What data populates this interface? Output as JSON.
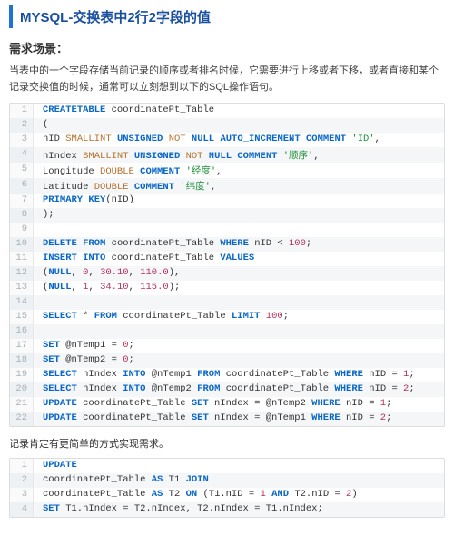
{
  "title": "MYSQL-交换表中2行2字段的值",
  "section_heading": "需求场景：",
  "paragraph": "当表中的一个字段存储当前记录的顺序或者排名时候，它需要进行上移或者下移，或者直接和某个记录交换值的时候，通常可以立刻想到以下的SQL操作语句。",
  "note": "记录肯定有更简单的方式实现需求。",
  "block1": [
    {
      "n": "1",
      "tokens": [
        [
          "kw",
          "CREATE"
        ],
        [
          "",
          ""
        ],
        [
          "kw",
          "TABLE"
        ],
        [
          "",
          " coordinatePt_Table"
        ]
      ]
    },
    {
      "n": "2",
      "tokens": [
        [
          "",
          "("
        ]
      ]
    },
    {
      "n": "3",
      "tokens": [
        [
          "",
          "nID "
        ],
        [
          "type",
          "SMALLINT"
        ],
        [
          "",
          " "
        ],
        [
          "kw",
          "UNSIGNED"
        ],
        [
          "",
          " "
        ],
        [
          "type",
          "NOT"
        ],
        [
          "",
          " "
        ],
        [
          "kw",
          "NULL"
        ],
        [
          "",
          " "
        ],
        [
          "kw",
          "AUTO_INCREMENT"
        ],
        [
          "",
          " "
        ],
        [
          "kw",
          "COMMENT"
        ],
        [
          "",
          " "
        ],
        [
          "str",
          "'ID'"
        ],
        [
          "",
          ","
        ]
      ]
    },
    {
      "n": "4",
      "tokens": [
        [
          "",
          "nIndex "
        ],
        [
          "type",
          "SMALLINT"
        ],
        [
          "",
          " "
        ],
        [
          "kw",
          "UNSIGNED"
        ],
        [
          "",
          " "
        ],
        [
          "type",
          "NOT"
        ],
        [
          "",
          " "
        ],
        [
          "kw",
          "NULL"
        ],
        [
          "",
          " "
        ],
        [
          "kw",
          "COMMENT"
        ],
        [
          "",
          " "
        ],
        [
          "str",
          "'顺序'"
        ],
        [
          "",
          ","
        ]
      ]
    },
    {
      "n": "5",
      "tokens": [
        [
          "",
          "Longitude "
        ],
        [
          "type",
          "DOUBLE"
        ],
        [
          "",
          " "
        ],
        [
          "kw",
          "COMMENT"
        ],
        [
          "",
          " "
        ],
        [
          "str",
          "'经度'"
        ],
        [
          "",
          ","
        ]
      ]
    },
    {
      "n": "6",
      "tokens": [
        [
          "",
          "Latitude "
        ],
        [
          "type",
          "DOUBLE"
        ],
        [
          "",
          " "
        ],
        [
          "kw",
          "COMMENT"
        ],
        [
          "",
          " "
        ],
        [
          "str",
          "'纬度'"
        ],
        [
          "",
          ","
        ]
      ]
    },
    {
      "n": "7",
      "tokens": [
        [
          "kw",
          "PRIMARY"
        ],
        [
          "",
          " "
        ],
        [
          "kw",
          "KEY"
        ],
        [
          "",
          "(nID)"
        ]
      ]
    },
    {
      "n": "8",
      "tokens": [
        [
          "",
          ");"
        ]
      ]
    },
    {
      "n": "9",
      "tokens": [
        [
          "",
          ""
        ]
      ]
    },
    {
      "n": "10",
      "tokens": [
        [
          "kw",
          "DELETE"
        ],
        [
          "",
          " "
        ],
        [
          "kw",
          "FROM"
        ],
        [
          "",
          " coordinatePt_Table "
        ],
        [
          "kw",
          "WHERE"
        ],
        [
          "",
          " nID < "
        ],
        [
          "num",
          "100"
        ],
        [
          "",
          ";"
        ]
      ]
    },
    {
      "n": "11",
      "tokens": [
        [
          "kw",
          "INSERT"
        ],
        [
          "",
          " "
        ],
        [
          "kw",
          "INTO"
        ],
        [
          "",
          " coordinatePt_Table "
        ],
        [
          "kw",
          "VALUES"
        ]
      ]
    },
    {
      "n": "12",
      "tokens": [
        [
          "",
          "("
        ],
        [
          "kw",
          "NULL"
        ],
        [
          "",
          ", "
        ],
        [
          "num",
          "0"
        ],
        [
          "",
          ", "
        ],
        [
          "num",
          "30.10"
        ],
        [
          "",
          ", "
        ],
        [
          "num",
          "110.0"
        ],
        [
          "",
          "),"
        ]
      ]
    },
    {
      "n": "13",
      "tokens": [
        [
          "",
          "("
        ],
        [
          "kw",
          "NULL"
        ],
        [
          "",
          ", "
        ],
        [
          "num",
          "1"
        ],
        [
          "",
          ", "
        ],
        [
          "num",
          "34.10"
        ],
        [
          "",
          ", "
        ],
        [
          "num",
          "115.0"
        ],
        [
          "",
          ");"
        ]
      ]
    },
    {
      "n": "14",
      "tokens": [
        [
          "",
          ""
        ]
      ]
    },
    {
      "n": "15",
      "tokens": [
        [
          "kw",
          "SELECT"
        ],
        [
          "",
          " * "
        ],
        [
          "kw",
          "FROM"
        ],
        [
          "",
          " coordinatePt_Table "
        ],
        [
          "kw",
          "LIMIT"
        ],
        [
          "",
          " "
        ],
        [
          "num",
          "100"
        ],
        [
          "",
          ";"
        ]
      ]
    },
    {
      "n": "16",
      "tokens": [
        [
          "",
          ""
        ]
      ]
    },
    {
      "n": "17",
      "tokens": [
        [
          "kw",
          "SET"
        ],
        [
          "",
          " @nTemp1 = "
        ],
        [
          "num",
          "0"
        ],
        [
          "",
          ";"
        ]
      ]
    },
    {
      "n": "18",
      "tokens": [
        [
          "kw",
          "SET"
        ],
        [
          "",
          " @nTemp2 = "
        ],
        [
          "num",
          "0"
        ],
        [
          "",
          ";"
        ]
      ]
    },
    {
      "n": "19",
      "tokens": [
        [
          "kw",
          "SELECT"
        ],
        [
          "",
          " nIndex "
        ],
        [
          "kw",
          "INTO"
        ],
        [
          "",
          " @nTemp1 "
        ],
        [
          "kw",
          "FROM"
        ],
        [
          "",
          " coordinatePt_Table "
        ],
        [
          "kw",
          "WHERE"
        ],
        [
          "",
          " nID = "
        ],
        [
          "num",
          "1"
        ],
        [
          "",
          ";"
        ]
      ]
    },
    {
      "n": "20",
      "tokens": [
        [
          "kw",
          "SELECT"
        ],
        [
          "",
          " nIndex "
        ],
        [
          "kw",
          "INTO"
        ],
        [
          "",
          " @nTemp2 "
        ],
        [
          "kw",
          "FROM"
        ],
        [
          "",
          " coordinatePt_Table "
        ],
        [
          "kw",
          "WHERE"
        ],
        [
          "",
          " nID = "
        ],
        [
          "num",
          "2"
        ],
        [
          "",
          ";"
        ]
      ]
    },
    {
      "n": "21",
      "tokens": [
        [
          "kw",
          "UPDATE"
        ],
        [
          "",
          " coordinatePt_Table "
        ],
        [
          "kw",
          "SET"
        ],
        [
          "",
          " nIndex = @nTemp2 "
        ],
        [
          "kw",
          "WHERE"
        ],
        [
          "",
          " nID = "
        ],
        [
          "num",
          "1"
        ],
        [
          "",
          ";"
        ]
      ]
    },
    {
      "n": "22",
      "tokens": [
        [
          "kw",
          "UPDATE"
        ],
        [
          "",
          " coordinatePt_Table "
        ],
        [
          "kw",
          "SET"
        ],
        [
          "",
          " nIndex = @nTemp1 "
        ],
        [
          "kw",
          "WHERE"
        ],
        [
          "",
          " nID = "
        ],
        [
          "num",
          "2"
        ],
        [
          "",
          ";"
        ]
      ]
    }
  ],
  "block2": [
    {
      "n": "1",
      "tokens": [
        [
          "kw",
          "UPDATE"
        ]
      ]
    },
    {
      "n": "2",
      "tokens": [
        [
          "",
          "coordinatePt_Table "
        ],
        [
          "kw",
          "AS"
        ],
        [
          "",
          " T1 "
        ],
        [
          "kw",
          "JOIN"
        ]
      ]
    },
    {
      "n": "3",
      "tokens": [
        [
          "",
          "coordinatePt_Table "
        ],
        [
          "kw",
          "AS"
        ],
        [
          "",
          " T2 "
        ],
        [
          "kw",
          "ON"
        ],
        [
          "",
          " (T1.nID = "
        ],
        [
          "num",
          "1"
        ],
        [
          "",
          " "
        ],
        [
          "kw",
          "AND"
        ],
        [
          "",
          " T2.nID = "
        ],
        [
          "num",
          "2"
        ],
        [
          "",
          ")"
        ]
      ]
    },
    {
      "n": "4",
      "tokens": [
        [
          "kw",
          "SET"
        ],
        [
          "",
          " T1.nIndex = T2.nIndex, T2.nIndex = T1.nIndex;"
        ]
      ]
    }
  ]
}
